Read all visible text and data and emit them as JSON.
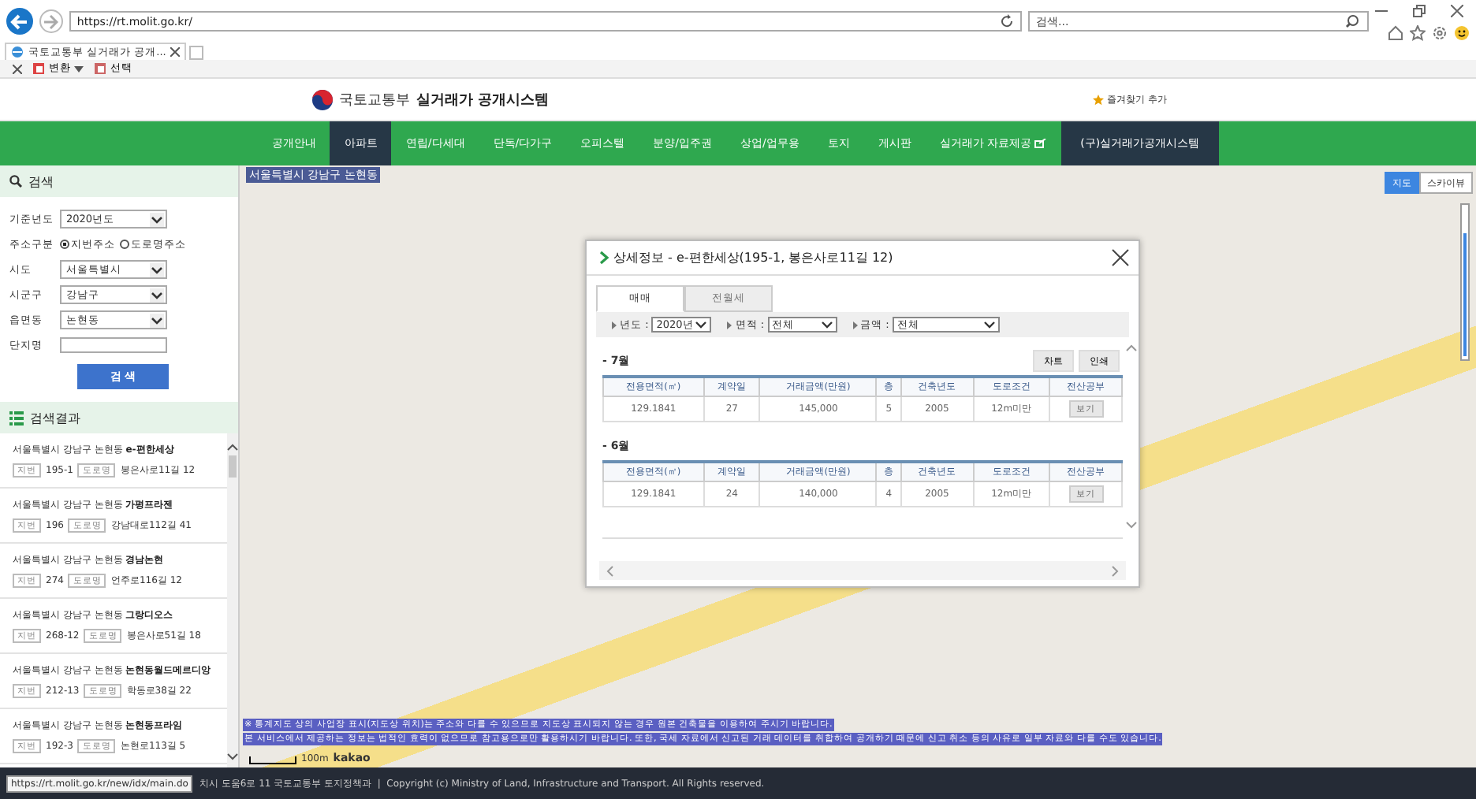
{
  "browser": {
    "address": "https://rt.molit.go.kr/",
    "search_placeholder": "검색...",
    "tabs": [
      {
        "label": "국토교통부 실거래가 공개...",
        "selected": true
      }
    ],
    "favorites_bar": [
      "변환",
      "선택"
    ]
  },
  "header": {
    "ministry": "국토교통부",
    "system": "실거래가 공개시스템",
    "bookmark": "즐겨찾기 추가"
  },
  "nav": [
    {
      "label": "공개안내",
      "selected": false,
      "kind": "menu"
    },
    {
      "label": "아파트",
      "selected": true,
      "kind": "menu"
    },
    {
      "label": "연립/다세대",
      "selected": false,
      "kind": "menu"
    },
    {
      "label": "단독/다가구",
      "selected": false,
      "kind": "menu"
    },
    {
      "label": "오피스텔",
      "selected": false,
      "kind": "menu"
    },
    {
      "label": "분양/입주권",
      "selected": false,
      "kind": "menu"
    },
    {
      "label": "상업/업무용",
      "selected": false,
      "kind": "menu"
    },
    {
      "label": "토지",
      "selected": false,
      "kind": "menu"
    },
    {
      "label": "게시판",
      "selected": false,
      "kind": "menu"
    },
    {
      "label": "실거래가 자료제공",
      "selected": false,
      "kind": "external"
    },
    {
      "label": "(구)실거래가공개시스템",
      "selected": false,
      "kind": "legacy"
    }
  ],
  "search_panel": {
    "title": "검색",
    "fields": [
      {
        "label": "기준년도",
        "kind": "select",
        "value": "2020년도"
      },
      {
        "label": "주소구분",
        "kind": "radio",
        "options": [
          {
            "label": "지번주소",
            "selected": true
          },
          {
            "label": "도로명주소",
            "selected": false
          }
        ]
      },
      {
        "label": "시도",
        "kind": "select",
        "value": "서울특별시"
      },
      {
        "label": "시군구",
        "kind": "select",
        "value": "강남구"
      },
      {
        "label": "읍면동",
        "kind": "select",
        "value": "논현동"
      },
      {
        "label": "단지명",
        "kind": "text"
      }
    ],
    "button": "검 색"
  },
  "results": {
    "title": "검색결과",
    "items": [
      {
        "name": "서울특별시 강남구 논현동 **e-편한세상**",
        "lot_tag": "지번",
        "lot": "195-1",
        "road_tag": "도로명",
        "road": "봉은사로11길 12"
      },
      {
        "name": "서울특별시 강남구 논현동 **가평프라젠**",
        "lot_tag": "지번",
        "lot": "196",
        "road_tag": "도로명",
        "road": "강남대로112길 41"
      },
      {
        "name": "서울특별시 강남구 논현동 **경남논현**",
        "lot_tag": "지번",
        "lot": "274",
        "road_tag": "도로명",
        "road": "언주로116길 12"
      },
      {
        "name": "서울특별시 강남구 논현동 **그랑디오스**",
        "lot_tag": "지번",
        "lot": "268-12",
        "road_tag": "도로명",
        "road": "봉은사로51길 18"
      },
      {
        "name": "서울특별시 강남구 논현동 **논현동월드메르디앙**",
        "lot_tag": "지번",
        "lot": "212-13",
        "road_tag": "도로명",
        "road": "학동로38길 22"
      },
      {
        "name": "서울특별시 강남구 논현동 **논현동프라임**",
        "lot_tag": "지번",
        "lot": "192-3",
        "road_tag": "도로명",
        "road": "논현로113길 5"
      }
    ]
  },
  "map": {
    "location": "서울특별시 강남구 논현동",
    "zoom": {
      "level": 0.8
    },
    "map_types": [
      {
        "label": "지도",
        "selected": true
      },
      {
        "label": "스카이뷰",
        "selected": false
      }
    ],
    "scale": "100m",
    "provider": "kakao",
    "notices": [
      "※ 통계지도 상의 사업장 표시(지도상 위치)는 주소와 다를 수 있으므로 지도상 표시되지 않는 경우 원본 건축물을 이용하여 주시기 바랍니다.",
      "본 서비스에서 제공하는 정보는 법적인 효력이 없으므로 참고용으로만 활용하시기 바랍니다. 또한, 국세 자료에서 신고된 거래 데이터를 취합하여 공개하기 때문에 신고 취소 등의 사유로 일부 자료와 다를 수도 있습니다."
    ]
  },
  "detail": {
    "title": "상세정보 - e-편한세상(195-1, 봉은사로11길 12)",
    "tabs": [
      {
        "label": "매매",
        "selected": true
      },
      {
        "label": "전월세",
        "selected": false
      }
    ],
    "filters": [
      {
        "label": "년도 :",
        "value": "2020년"
      },
      {
        "label": "면적 :",
        "value": "전체"
      },
      {
        "label": "금액 :",
        "value": "전체"
      }
    ],
    "buttons": [
      "차트",
      "인쇄"
    ],
    "months": [
      {
        "label": "- 7월",
        "columns": [
          "전용면적(㎡)",
          "계약일",
          "거래금액(만원)",
          "층",
          "건축년도",
          "도로조건",
          "전산공부"
        ],
        "rows": [
          [
            "129.1841",
            "27",
            "145,000",
            "5",
            "2005",
            "12m미만",
            "보기"
          ]
        ]
      },
      {
        "label": "- 6월",
        "columns": [
          "전용면적(㎡)",
          "계약일",
          "거래금액(만원)",
          "층",
          "건축년도",
          "도로조건",
          "전산공부"
        ],
        "rows": [
          [
            "129.1841",
            "24",
            "140,000",
            "4",
            "2005",
            "12m미만",
            "보기"
          ]
        ]
      }
    ]
  },
  "footer": "치시 도움6로 11 국토교통부 토지정책과  |  Copyright (c) Ministry of Land, Infrastructure and Transport. All Rights reserved.",
  "status_url": "https://rt.molit.go.kr/new/idx/main.do"
}
